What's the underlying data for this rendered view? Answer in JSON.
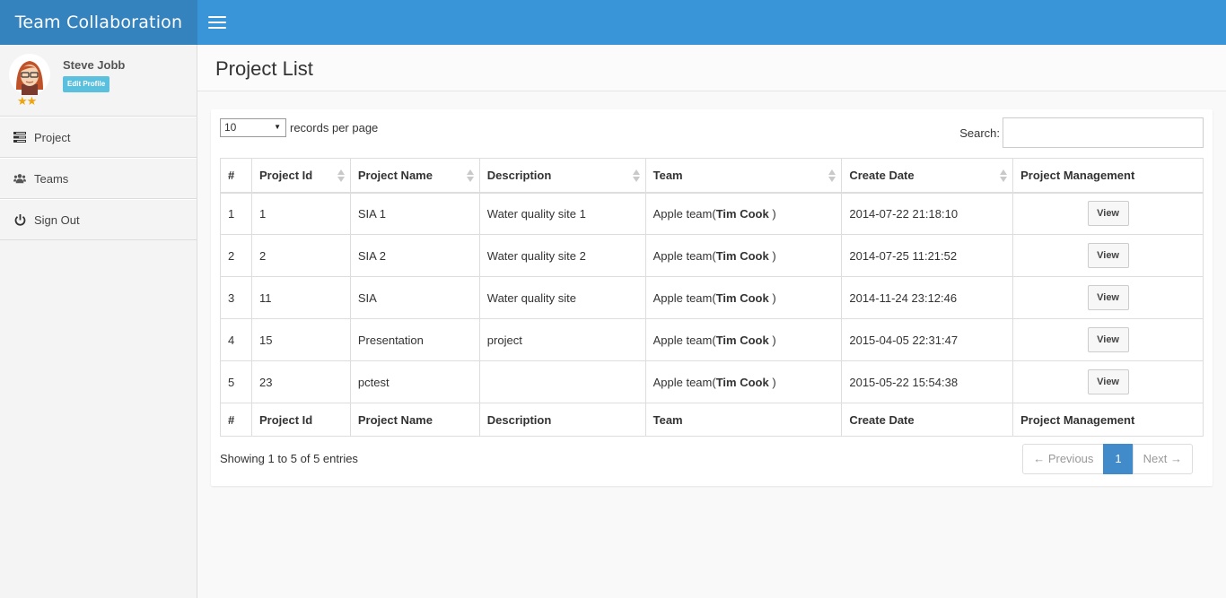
{
  "app": {
    "brand": "Team Collaboration"
  },
  "user": {
    "name": "Steve Jobb",
    "edit_label": "Edit Profile",
    "stars": "★★"
  },
  "sidebar": {
    "items": [
      {
        "label": "Project",
        "icon": "tasks-icon"
      },
      {
        "label": "Teams",
        "icon": "users-icon"
      },
      {
        "label": "Sign Out",
        "icon": "power-icon"
      }
    ]
  },
  "page": {
    "title": "Project List"
  },
  "controls": {
    "length_value": "10",
    "length_label": "records per page",
    "search_label": "Search:",
    "search_value": ""
  },
  "table": {
    "headers": [
      "#",
      "Project Id",
      "Project Name",
      "Description",
      "Team",
      "Create Date",
      "Project Management"
    ],
    "rows": [
      {
        "num": "1",
        "id": "1",
        "name": "SIA 1",
        "desc": "Water quality site 1",
        "team": "Apple team(",
        "lead": "Tim Cook",
        "team_end": " )",
        "date": "2014-07-22 21:18:10",
        "action": "View"
      },
      {
        "num": "2",
        "id": "2",
        "name": "SIA 2",
        "desc": "Water quality site 2",
        "team": "Apple team(",
        "lead": "Tim Cook",
        "team_end": " )",
        "date": "2014-07-25 11:21:52",
        "action": "View"
      },
      {
        "num": "3",
        "id": "11",
        "name": "SIA",
        "desc": "Water quality site",
        "team": "Apple team(",
        "lead": "Tim Cook",
        "team_end": " )",
        "date": "2014-11-24 23:12:46",
        "action": "View"
      },
      {
        "num": "4",
        "id": "15",
        "name": "Presentation",
        "desc": "project",
        "team": "Apple team(",
        "lead": "Tim Cook",
        "team_end": " )",
        "date": "2015-04-05 22:31:47",
        "action": "View"
      },
      {
        "num": "5",
        "id": "23",
        "name": "pctest",
        "desc": "",
        "team": "Apple team(",
        "lead": "Tim Cook",
        "team_end": " )",
        "date": "2015-05-22 15:54:38",
        "action": "View"
      }
    ]
  },
  "footer": {
    "info": "Showing 1 to 5 of 5 entries",
    "prev": "← Previous",
    "page": "1",
    "next": "Next →"
  },
  "colors": {
    "topbar": "#3a95d8",
    "brand_bg": "#3583be",
    "badge": "#5bc0de",
    "pager_active": "#428bca"
  }
}
